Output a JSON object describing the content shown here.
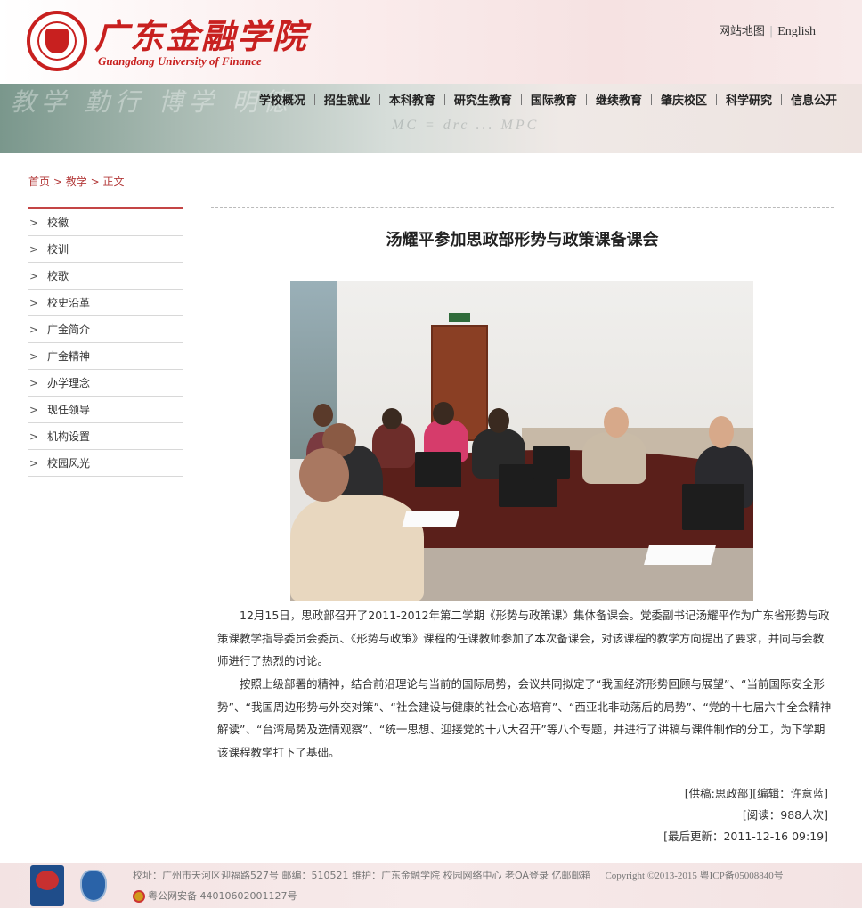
{
  "header": {
    "logo_cn": "广东金融学院",
    "logo_en": "Guangdong University of Finance",
    "links": [
      "网站地图",
      "English"
    ]
  },
  "nav": {
    "chalk_text": "教学 勤行 博学 明德",
    "formula_text": "MC = drc ... MPC",
    "items": [
      "学校概况",
      "招生就业",
      "本科教育",
      "研究生教育",
      "国际教育",
      "继续教育",
      "肇庆校区",
      "科学研究",
      "信息公开"
    ]
  },
  "breadcrumb": [
    "首页",
    ">",
    "教学",
    ">",
    "正文"
  ],
  "sidebar": {
    "items": [
      "校徽",
      "校训",
      "校歌",
      "校史沿革",
      "广金简介",
      "广金精神",
      "办学理念",
      "现任领导",
      "机构设置",
      "校园风光"
    ]
  },
  "article": {
    "title": "汤耀平参加思政部形势与政策课备课会",
    "paragraphs": [
      "12月15日，思政部召开了2011-2012年第二学期《形势与政策课》集体备课会。党委副书记汤耀平作为广东省形势与政策课教学指导委员会委员、《形势与政策》课程的任课教师参加了本次备课会，对该课程的教学方向提出了要求，并同与会教师进行了热烈的讨论。",
      "按照上级部署的精神，结合前沿理论与当前的国际局势，会议共同拟定了“我国经济形势回顾与展望”、“当前国际安全形势”、“我国周边形势与外交对策”、“社会建设与健康的社会心态培育”、“西亚北非动荡后的局势”、“党的十七届六中全会精神解读”、“台湾局势及选情观察”、“统一思想、迎接党的十八大召开”等八个专题，并进行了讲稿与课件制作的分工，为下学期该课程教学打下了基础。"
    ],
    "source": "[供稿:思政部][编辑：许意蓝]",
    "reads": "[阅读：988人次]",
    "updated": "[最后更新：2011-12-16 09:19]"
  },
  "footer": {
    "address": "校址：广州市天河区迎福路527号 邮编：510521 维护：广东金融学院 校园网络中心 老OA登录 亿邮邮箱",
    "copyright": "Copyright ©2013-2015 粤ICP备05008840号",
    "police": "粤公网安备 44010602001127号"
  }
}
